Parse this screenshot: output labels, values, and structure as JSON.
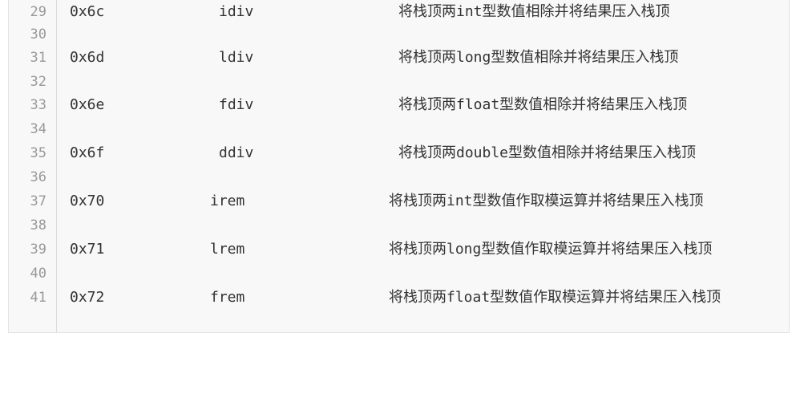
{
  "line_numbers": [
    "29",
    "30",
    "31",
    "32",
    "33",
    "34",
    "35",
    "36",
    "37",
    "38",
    "39",
    "40",
    "41"
  ],
  "rows": [
    {
      "code": "0x6c",
      "mnemonic": "idiv",
      "desc": "将栈顶两int型数值相除并将结果压入栈顶"
    },
    {
      "code": "0x6d",
      "mnemonic": "ldiv",
      "desc": "将栈顶两long型数值相除并将结果压入栈顶"
    },
    {
      "code": "0x6e",
      "mnemonic": "fdiv",
      "desc": "将栈顶两float型数值相除并将结果压入栈顶"
    },
    {
      "code": "0x6f",
      "mnemonic": "ddiv",
      "desc": "将栈顶两double型数值相除并将结果压入栈顶"
    },
    {
      "code": "0x70",
      "mnemonic": "irem",
      "desc": "将栈顶两int型数值作取模运算并将结果压入栈顶"
    },
    {
      "code": "0x71",
      "mnemonic": "lrem",
      "desc": "将栈顶两long型数值作取模运算并将结果压入栈顶"
    },
    {
      "code": "0x72",
      "mnemonic": "frem",
      "desc": "将栈顶两float型数值作取模运算并将结果压入栈顶"
    }
  ],
  "colors": {
    "background": "#f8f8f8",
    "line_number": "#999999",
    "text": "#333333"
  }
}
